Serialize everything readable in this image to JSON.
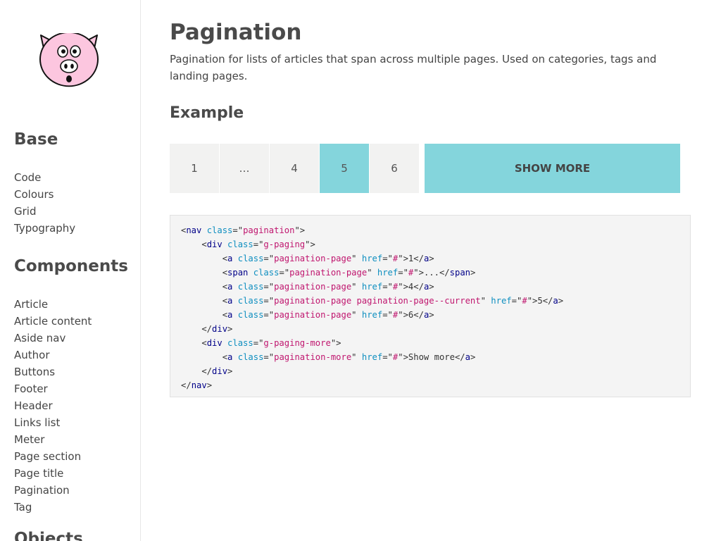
{
  "sidebar": {
    "sections": [
      {
        "heading": "Base",
        "items": [
          "Code",
          "Colours",
          "Grid",
          "Typography"
        ]
      },
      {
        "heading": "Components",
        "items": [
          "Article",
          "Article content",
          "Aside nav",
          "Author",
          "Buttons",
          "Footer",
          "Header",
          "Links list",
          "Meter",
          "Page section",
          "Page title",
          "Pagination",
          "Tag"
        ]
      },
      {
        "heading": "Objects"
      }
    ]
  },
  "main": {
    "title": "Pagination",
    "intro": "Pagination for lists of articles that span across multiple pages. Used on categories, tags and landing pages.",
    "example_heading": "Example",
    "pagination": {
      "pages": [
        "1",
        "…",
        "4",
        "5",
        "6"
      ],
      "current": "5",
      "show_more": "Show more"
    },
    "code_lines": [
      "<nav class=\"pagination\">",
      "    <div class=\"g-paging\">",
      "        <a class=\"pagination-page\" href=\"#\">1</a>",
      "        <span class=\"pagination-page\" href=\"#\">...</span>",
      "        <a class=\"pagination-page\" href=\"#\">4</a>",
      "        <a class=\"pagination-page pagination-page--current\" href=\"#\">5</a>",
      "        <a class=\"pagination-page\" href=\"#\">6</a>",
      "    </div>",
      "    <div class=\"g-paging-more\">",
      "        <a class=\"pagination-more\" href=\"#\">Show more</a>",
      "    </div>",
      "</nav>"
    ]
  },
  "colors": {
    "accent": "#84d5dc",
    "page_bg": "#f2f2f1",
    "code_bg": "#f4f4f4",
    "pig_pink": "#fcc6df"
  },
  "logo": {
    "icon": "pig-face-icon"
  }
}
